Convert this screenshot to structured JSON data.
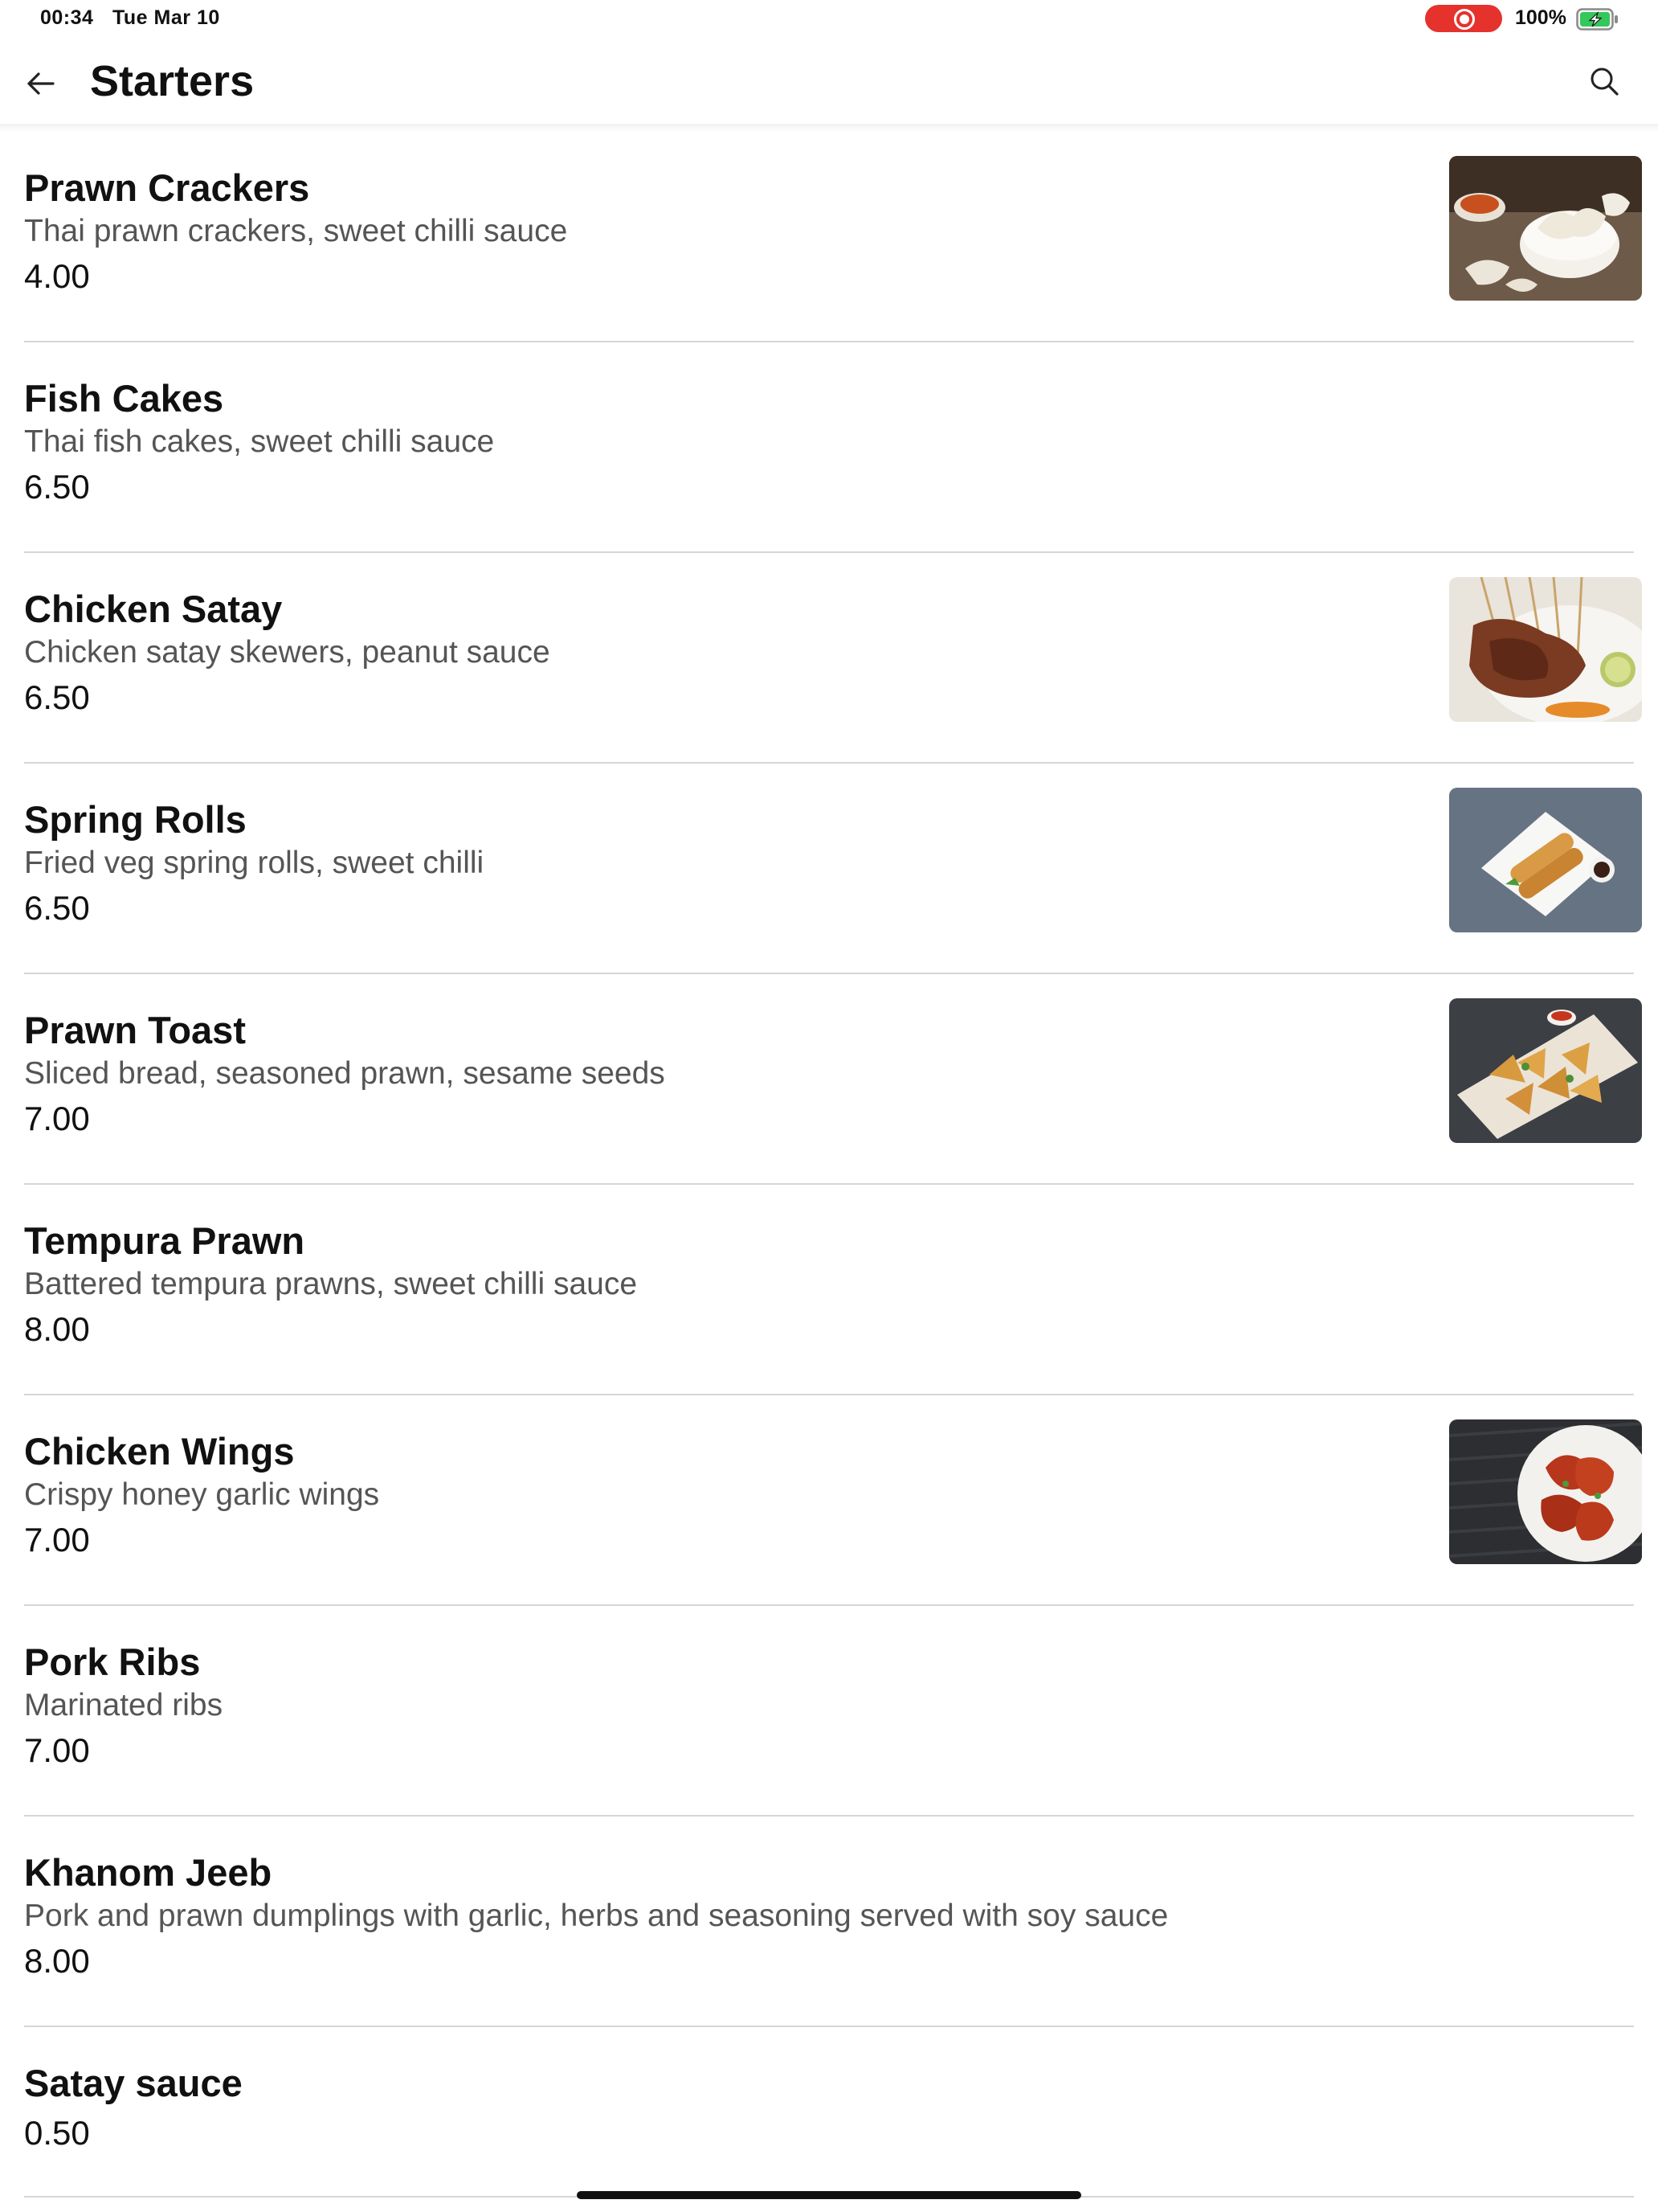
{
  "status_bar": {
    "time": "00:34",
    "date": "Tue Mar 10",
    "battery_percent": "100%",
    "battery_level": 1.0,
    "recording_color": "#e5322d",
    "battery_color": "#34c759"
  },
  "header": {
    "title": "Starters",
    "back_icon": "arrow-left-icon",
    "search_icon": "search-icon"
  },
  "items": [
    {
      "name": "Prawn Crackers",
      "description": "Thai prawn crackers, sweet chilli sauce",
      "price": "4.00",
      "has_image": true,
      "image": "prawn-crackers-photo"
    },
    {
      "name": "Fish Cakes",
      "description": "Thai fish cakes, sweet chilli sauce",
      "price": "6.50",
      "has_image": false
    },
    {
      "name": "Chicken Satay",
      "description": "Chicken satay skewers, peanut sauce",
      "price": "6.50",
      "has_image": true,
      "image": "chicken-satay-photo"
    },
    {
      "name": "Spring Rolls",
      "description": "Fried veg spring rolls, sweet chilli",
      "price": "6.50",
      "has_image": true,
      "image": "spring-rolls-photo"
    },
    {
      "name": "Prawn Toast",
      "description": "Sliced bread, seasoned prawn, sesame seeds",
      "price": "7.00",
      "has_image": true,
      "image": "prawn-toast-photo"
    },
    {
      "name": "Tempura Prawn",
      "description": "Battered tempura prawns, sweet chilli sauce",
      "price": "8.00",
      "has_image": false
    },
    {
      "name": "Chicken Wings",
      "description": "Crispy honey garlic wings",
      "price": "7.00",
      "has_image": true,
      "image": "chicken-wings-photo"
    },
    {
      "name": "Pork Ribs",
      "description": "Marinated ribs",
      "price": "7.00",
      "has_image": false
    },
    {
      "name": "Khanom Jeeb",
      "description": "Pork and prawn dumplings with garlic, herbs and seasoning served with soy sauce",
      "price": "8.00",
      "has_image": false
    },
    {
      "name": "Satay sauce",
      "price": "0.50",
      "has_image": false
    }
  ]
}
